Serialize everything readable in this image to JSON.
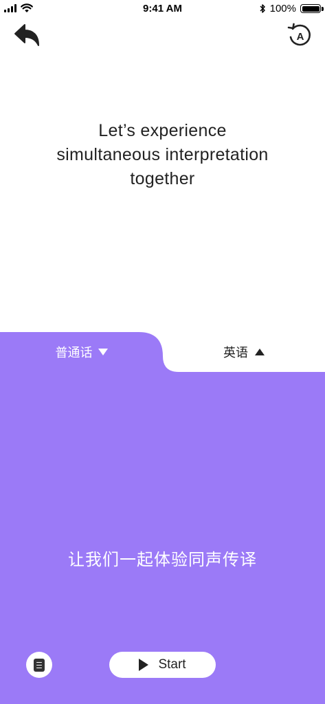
{
  "status_bar": {
    "time": "9:41 AM",
    "battery_text": "100%",
    "battery_level": 1.0
  },
  "nav": {
    "back_icon": "undo-arrow-icon",
    "history_icon": "history-language-icon",
    "history_letter": "A"
  },
  "headline": {
    "line1": "Let’s experience",
    "line2": "simultaneous interpretation",
    "line3": "together"
  },
  "languages": {
    "source": "普通话",
    "target": "英语"
  },
  "panel": {
    "prompt": "让我们一起体验同声传译",
    "start_label": "Start"
  },
  "colors": {
    "accent": "#9b7af7",
    "text_dark": "#222222",
    "background": "#ffffff"
  }
}
